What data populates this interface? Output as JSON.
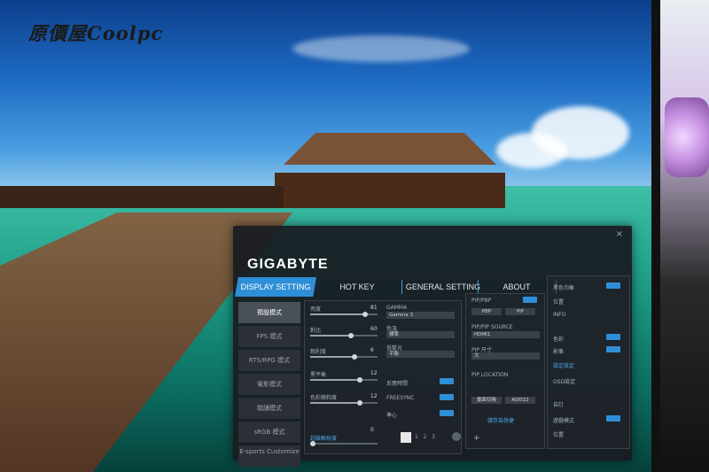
{
  "watermark": {
    "text": "原價屋Coolpc"
  },
  "osd": {
    "brand": "GIGABYTE",
    "close_label": "×",
    "tabs": [
      {
        "label": "DISPLAY SETTING"
      },
      {
        "label": "HOT KEY"
      },
      {
        "label": "GENERAL SETTING"
      },
      {
        "label": "ABOUT"
      }
    ],
    "modes": [
      {
        "label": "預設模式"
      },
      {
        "label": "FPS 模式"
      },
      {
        "label": "RTS/RPG 模式"
      },
      {
        "label": "電影模式"
      },
      {
        "label": "閱讀模式"
      },
      {
        "label": "sRGB 模式"
      },
      {
        "label": "E-sports Customize"
      }
    ],
    "picture": {
      "sliders": [
        {
          "label": "亮度",
          "value": "81"
        },
        {
          "label": "對比",
          "value": "60"
        },
        {
          "label": "銳利度",
          "value": "6"
        },
        {
          "label": "黑平衡",
          "value": "12"
        },
        {
          "label": "色彩飽和度",
          "value": "12"
        },
        {
          "label": "超級解析度",
          "value": "0"
        }
      ],
      "gamma_label": "GAMMA",
      "gamma_value": "Gamma 3",
      "color_temp_label": "色溫",
      "color_temp_value": "標準",
      "low_blue_label": "低藍光",
      "low_blue_value": "平衡",
      "overdrive_label": "反應時間",
      "freesync_label": "FREESYNC",
      "center_label": "準心",
      "pages": [
        "1",
        "2",
        "3"
      ]
    },
    "pip": {
      "title": "PIP/PBP",
      "pip_btn": "PIP",
      "pbp_btn": "PBP",
      "source_label": "PIP/PIP SOURCE",
      "source_value": "HDMI1",
      "size_label": "PIP 尺寸",
      "size_value": "大",
      "location_label": "PIP LOCATION",
      "loc_btn1": "畫面切換",
      "loc_btn2": "ADD22",
      "add_label": "儲存為快捷",
      "plus": "+"
    },
    "right": {
      "rows": [
        "黑色均衡",
        "位置",
        "INFO",
        "色彩",
        "影像",
        "OSD設定",
        "自訂",
        "遊戲模式",
        "位置"
      ],
      "link": "設定設定"
    }
  }
}
